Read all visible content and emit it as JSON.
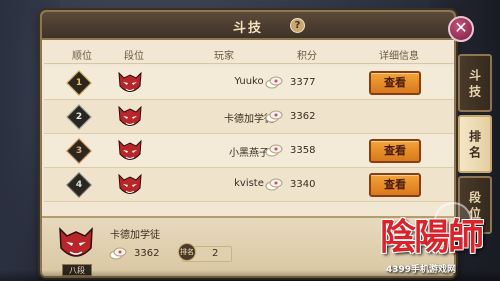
{
  "window": {
    "title": "斗技",
    "help_icon": "?"
  },
  "columns": {
    "rank": "顺位",
    "tier": "段位",
    "player": "玩家",
    "score": "积分",
    "details": "详细信息"
  },
  "rows": [
    {
      "rank": "1",
      "rank_style": "gold",
      "tier_icon": "oni-mask-icon",
      "name": "Yuuko",
      "score": "3377",
      "has_view": true,
      "view_label": "查看"
    },
    {
      "rank": "2",
      "rank_style": "silver",
      "tier_icon": "oni-mask-icon",
      "name": "卡德加学徒",
      "score": "3362",
      "has_view": false,
      "view_label": ""
    },
    {
      "rank": "3",
      "rank_style": "bronze",
      "tier_icon": "oni-mask-icon",
      "name": "小黑燕子",
      "score": "3358",
      "has_view": true,
      "view_label": "查看"
    },
    {
      "rank": "4",
      "rank_style": "plain",
      "tier_icon": "oni-mask-icon",
      "name": "kviste",
      "score": "3340",
      "has_view": true,
      "view_label": "查看"
    }
  ],
  "self": {
    "tier_label": "八段",
    "name": "卡德加学徒",
    "score": "3362",
    "rank_icon_text": "排名",
    "rank": "2"
  },
  "tabs": [
    {
      "label": "斗技",
      "active": false
    },
    {
      "label": "排名",
      "active": true
    },
    {
      "label": "段位",
      "active": false
    }
  ],
  "logo": {
    "title": "陰陽師",
    "subtitle": "4399手机游戏网"
  },
  "colors": {
    "panel_bg": "#f1e7d3",
    "button_orange": "#d9781d",
    "close_magenta": "#7a1f3f",
    "logo_red": "#d8242a"
  }
}
